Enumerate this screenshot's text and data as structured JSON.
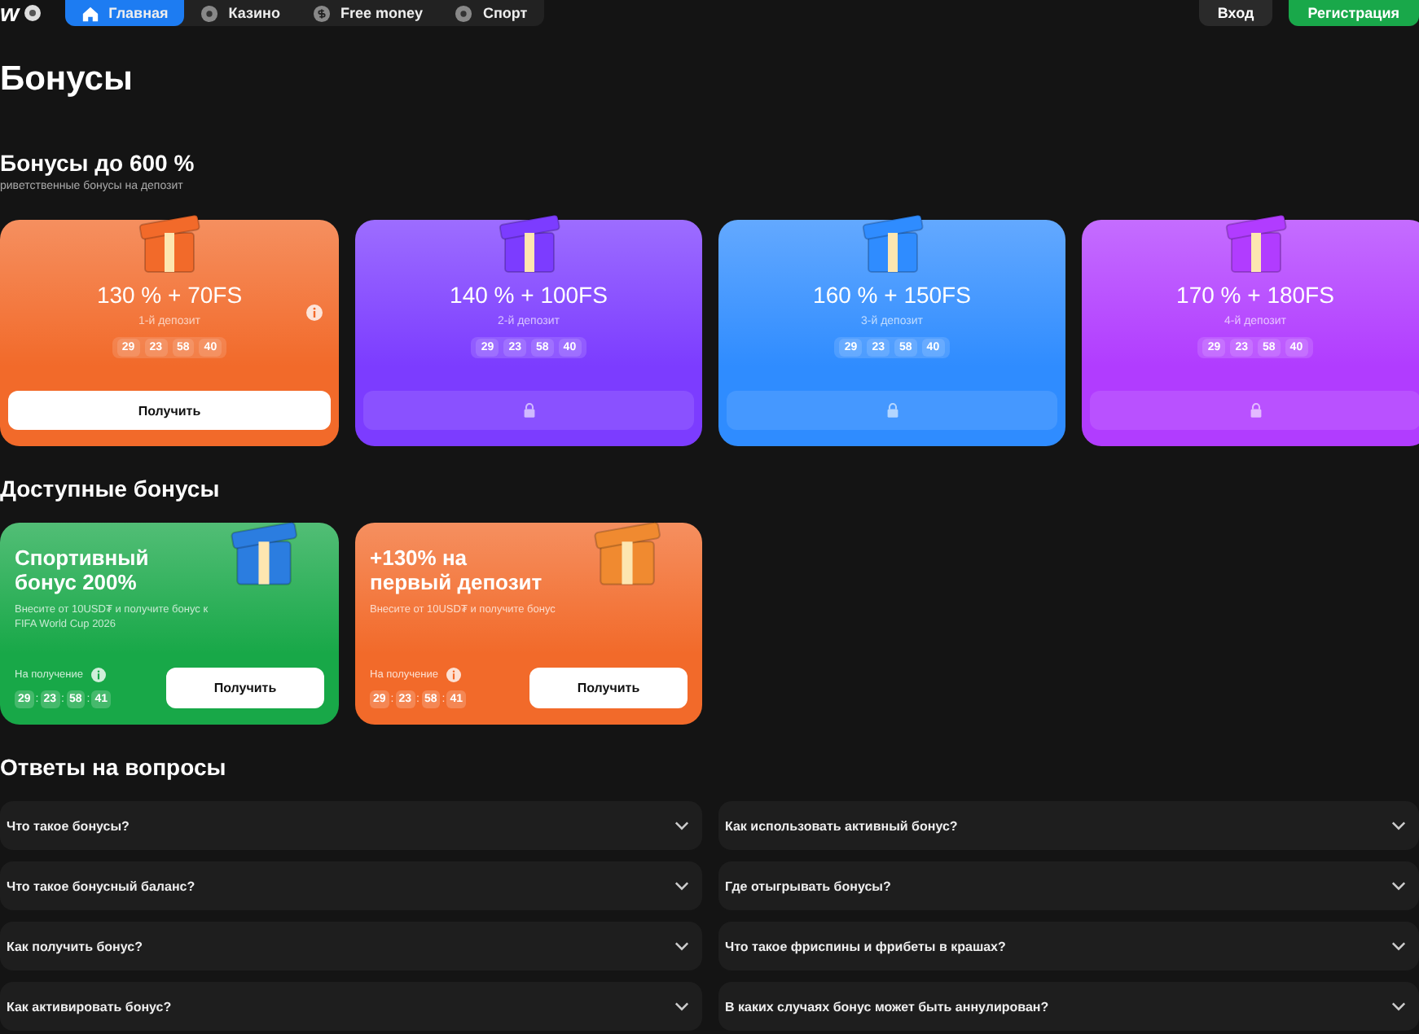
{
  "header": {
    "logo": "w",
    "tabs": [
      {
        "label": "Главная",
        "selected": true
      },
      {
        "label": "Казино",
        "selected": false
      },
      {
        "label": "Free money",
        "selected": false
      },
      {
        "label": "Спорт",
        "selected": false
      }
    ],
    "login": "Вход",
    "register": "Регистрация"
  },
  "page_title": "Бонусы",
  "deposit_bonuses": {
    "title": "Бонусы до 600 %",
    "subtitle": "риветственные бонусы на депозит",
    "cards": [
      {
        "amount": "130 % + 70FS",
        "deposit": "1-й депозит",
        "timer": [
          "29",
          "23",
          "58",
          "40"
        ],
        "color": "#f26a2a",
        "locked": false,
        "info": true,
        "button": "Получить"
      },
      {
        "amount": "140 % + 100FS",
        "deposit": "2-й депозит",
        "timer": [
          "29",
          "23",
          "58",
          "40"
        ],
        "color": "#7c3cff",
        "locked": true,
        "info": false
      },
      {
        "amount": "160 % + 150FS",
        "deposit": "3-й депозит",
        "timer": [
          "29",
          "23",
          "58",
          "40"
        ],
        "color": "#2f8cff",
        "locked": true,
        "info": false
      },
      {
        "amount": "170 % + 180FS",
        "deposit": "4-й депозит",
        "timer": [
          "29",
          "23",
          "58",
          "40"
        ],
        "color": "#b13cff",
        "locked": true,
        "info": false
      }
    ]
  },
  "available_bonuses": {
    "title": "Доступные бонусы",
    "cards": [
      {
        "title": "Спортивный бонус 200%",
        "description": "Внесите от 10USD₮ и получите бонус к FIFA World Cup 2026",
        "timer_label": "На получение",
        "timer": [
          "29",
          "23",
          "58",
          "41"
        ],
        "timer_separator": ":",
        "button": "Получить",
        "color": "#18a848"
      },
      {
        "title": "+130% на первый депозит",
        "description": "Внесите от 10USD₮ и получите бонус",
        "timer_label": "На получение",
        "timer": [
          "29",
          "23",
          "58",
          "41"
        ],
        "timer_separator": ":",
        "button": "Получить",
        "color": "#f26a2a"
      }
    ]
  },
  "faq": {
    "title": "Ответы на вопросы",
    "items": [
      {
        "question": "Что такое бонусы?",
        "expanded": false
      },
      {
        "question": "Как использовать активный бонус?",
        "expanded": false
      },
      {
        "question": "Что такое бонусный баланс?",
        "expanded": false
      },
      {
        "question": "Где отыгрывать бонусы?",
        "expanded": false
      },
      {
        "question": "Как получить бонус?",
        "expanded": false
      },
      {
        "question": "Что такое фриспины и фрибеты в крашах?",
        "expanded": false
      },
      {
        "question": "Как активировать бонус?",
        "expanded": false
      },
      {
        "question": "В каких случаях бонус может быть аннулирован?",
        "expanded": false
      }
    ]
  }
}
